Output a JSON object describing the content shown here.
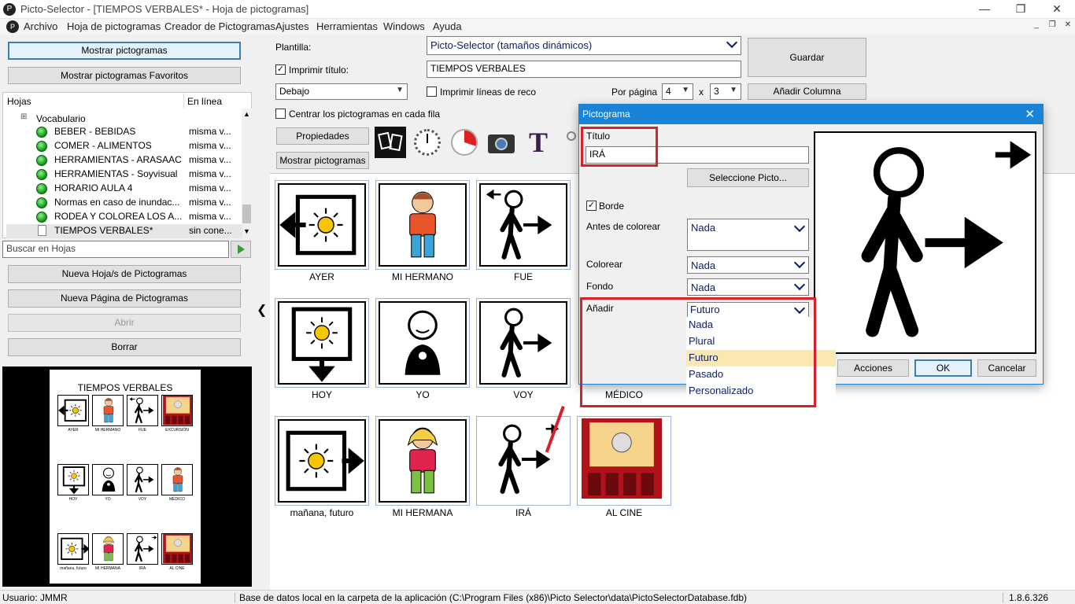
{
  "window": {
    "title": "Picto-Selector - [TIEMPOS VERBALES* - Hoja de pictogramas]",
    "minimize": "—",
    "restore": "❐",
    "close": "✕"
  },
  "menu": [
    "Archivo",
    "Hoja de pictogramas",
    "Creador de Pictogramas",
    "Ajustes",
    "Herramientas",
    "Windows",
    "Ayuda"
  ],
  "left": {
    "btn_show": "Mostrar pictogramas",
    "btn_favs": "Mostrar pictogramas Favoritos",
    "col_hojas": "Hojas",
    "col_online": "En línea",
    "tree_root": "Vocabulario",
    "sheets": [
      {
        "name": "BEBER - BEBIDAS",
        "online": "misma v..."
      },
      {
        "name": "COMER - ALIMENTOS",
        "online": "misma v..."
      },
      {
        "name": "HERRAMIENTAS - ARASAAC",
        "online": "misma v..."
      },
      {
        "name": "HERRAMIENTAS - Soyvisual",
        "online": "misma v..."
      },
      {
        "name": "HORARIO AULA 4",
        "online": "misma v..."
      },
      {
        "name": "Normas en caso de inundac...",
        "online": "misma v..."
      },
      {
        "name": "RODEA Y COLOREA LOS A...",
        "online": "misma v..."
      },
      {
        "name": "TIEMPOS VERBALES*",
        "online": "sin cone..."
      }
    ],
    "search_placeholder": "Buscar en Hojas",
    "btn_new_sheet": "Nueva Hoja/s de Pictogramas",
    "btn_new_page": "Nueva Página de Pictogramas",
    "btn_open": "Abrir",
    "btn_delete": "Borrar",
    "preview_title": "TIEMPOS VERBALES",
    "preview_labels": [
      "AYER",
      "MI HERMANO",
      "FUE",
      "EXCURSIÓN",
      "HOY",
      "YO",
      "VOY",
      "MÉDICO",
      "mañana, futuro",
      "MI HERMANA",
      "IRÁ",
      "AL CINE"
    ]
  },
  "toolbar": {
    "plantilla_label": "Plantilla:",
    "plantilla_value": "Picto-Selector (tamaños dinámicos)",
    "print_title_label": "Imprimir título:",
    "title_value": "TIEMPOS VERBALES",
    "pos_value": "Debajo",
    "print_lines_label": "Imprimir líneas de reco",
    "per_page_label": "Por página",
    "cols": "4",
    "x": "x",
    "rows": "3",
    "center_label": "Centrar los pictogramas en cada fila",
    "btn_guardar": "Guardar",
    "btn_add_col": "Añadir Columna",
    "btn_props": "Propiedades",
    "btn_show2": "Mostrar pictogramas",
    "text_tool": "T"
  },
  "grid": {
    "collapse_arrow": "❮",
    "labels": [
      "AYER",
      "MI HERMANO",
      "FUE",
      "HOY",
      "YO",
      "VOY",
      "MÉDICO",
      "mañana, futuro",
      "MI HERMANA",
      "IRÁ",
      "AL CINE"
    ]
  },
  "dialog": {
    "title": "Pictograma",
    "close": "✕",
    "titulo_label": "Título",
    "titulo_value": "IRÁ",
    "btn_select": "Seleccione Picto...",
    "borde_label": "Borde",
    "antes_label": "Antes de colorear",
    "antes_value": "Nada",
    "colorear_label": "Colorear",
    "colorear_value": "Nada",
    "fondo_label": "Fondo",
    "fondo_value": "Nada",
    "anadir_label": "Añadir",
    "anadir_value": "Futuro",
    "options": [
      "Nada",
      "Plural",
      "Futuro",
      "Pasado",
      "Personalizado"
    ],
    "btn_acciones": "Acciones",
    "btn_ok": "OK",
    "btn_cancel": "Cancelar"
  },
  "status": {
    "user": "Usuario: JMMR",
    "db": "Base de datos local en la carpeta de la aplicación (C:\\Program Files (x86)\\Picto Selector\\data\\PictoSelectorDatabase.fdb)",
    "version": "1.8.6.326"
  },
  "colors": {
    "accent": "#1883d7",
    "highlight_red": "#d7202a",
    "selected_item": "#fbe8b0"
  }
}
